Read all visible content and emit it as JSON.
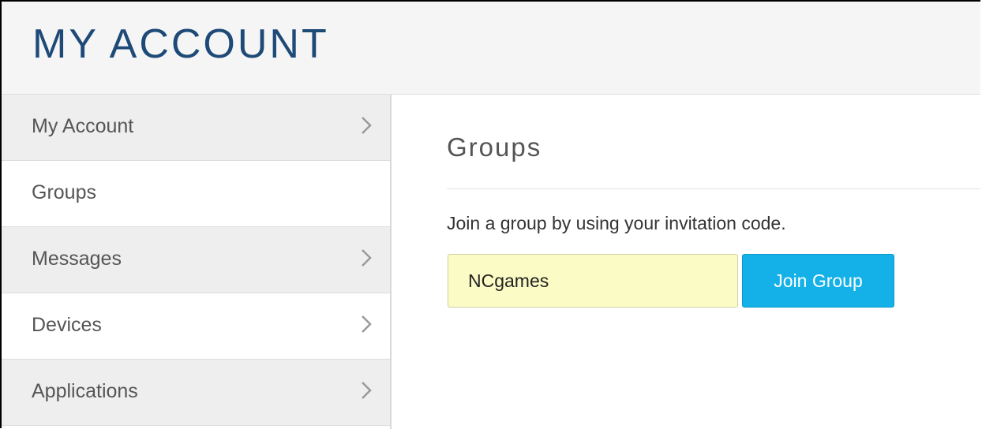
{
  "header": {
    "title": "MY ACCOUNT"
  },
  "sidebar": {
    "items": [
      {
        "label": "My Account",
        "chevron": true,
        "style": "gray"
      },
      {
        "label": "Groups",
        "chevron": false,
        "style": "white"
      },
      {
        "label": "Messages",
        "chevron": true,
        "style": "gray"
      },
      {
        "label": "Devices",
        "chevron": true,
        "style": "white"
      },
      {
        "label": "Applications",
        "chevron": true,
        "style": "gray"
      }
    ]
  },
  "main": {
    "section_title": "Groups",
    "description": "Join a group by using your invitation code.",
    "invitation_code": {
      "value": "NCgames",
      "placeholder": ""
    },
    "join_button_label": "Join Group"
  },
  "colors": {
    "title": "#1e4a78",
    "button": "#14b1e8",
    "input_background": "#fbfbc6",
    "sidebar_gray": "#eeeeee"
  }
}
